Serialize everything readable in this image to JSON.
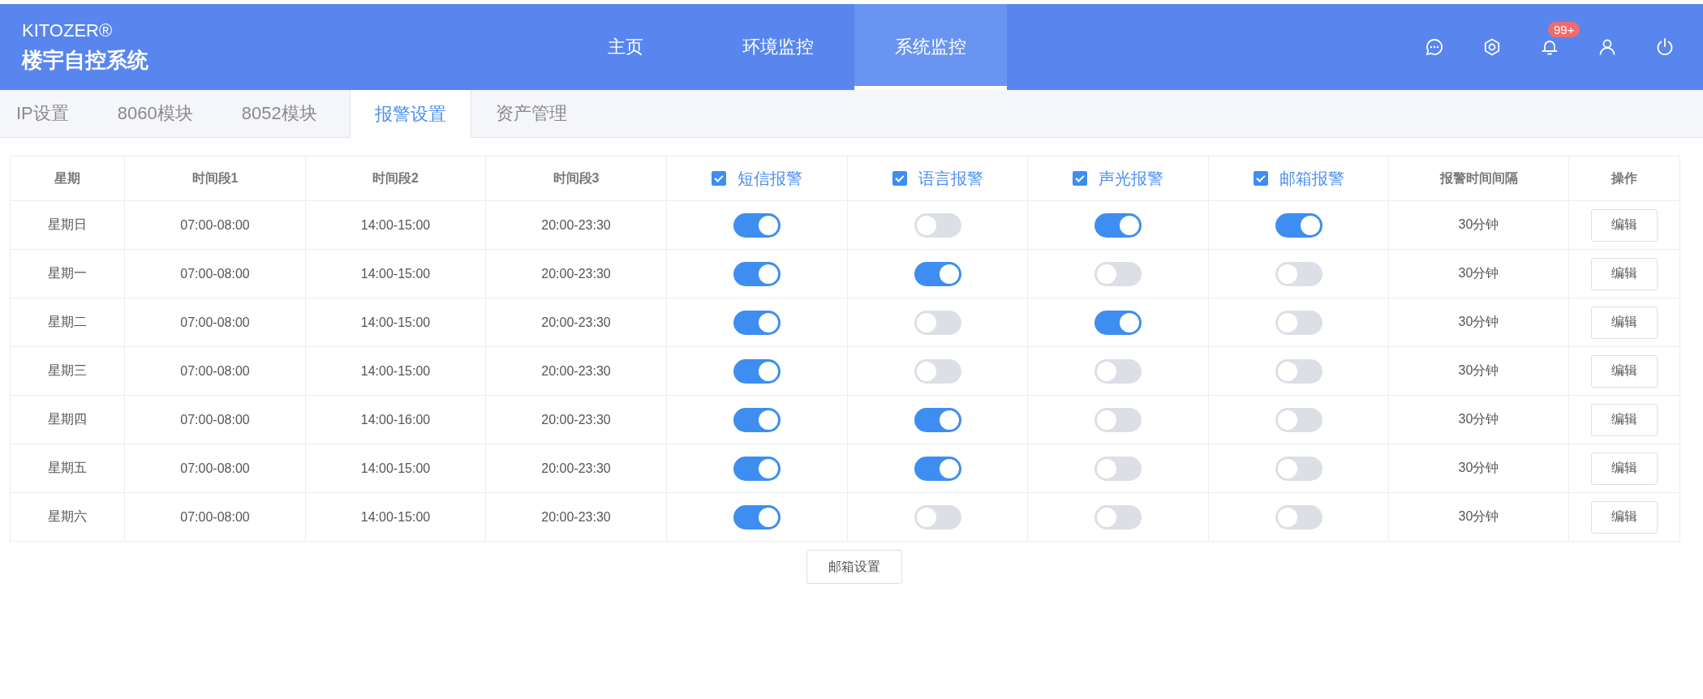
{
  "brand": {
    "name": "KITOZER®",
    "subtitle": "楼宇自控系统"
  },
  "nav": [
    {
      "label": "主页",
      "selected": false
    },
    {
      "label": "环境监控",
      "selected": false
    },
    {
      "label": "系统监控",
      "selected": true
    }
  ],
  "notification_badge": "99+",
  "subtabs": [
    {
      "label": "IP设置",
      "selected": false
    },
    {
      "label": "8060模块",
      "selected": false
    },
    {
      "label": "8052模块",
      "selected": false
    },
    {
      "label": "报警设置",
      "selected": true
    },
    {
      "label": "资产管理",
      "selected": false
    }
  ],
  "table": {
    "columns": [
      {
        "label": "星期",
        "kind": "text"
      },
      {
        "label": "时间段1",
        "kind": "text"
      },
      {
        "label": "时间段2",
        "kind": "text"
      },
      {
        "label": "时间段3",
        "kind": "text"
      },
      {
        "label": "短信报警",
        "kind": "check",
        "checked": true
      },
      {
        "label": "语言报警",
        "kind": "check",
        "checked": true
      },
      {
        "label": "声光报警",
        "kind": "check",
        "checked": true
      },
      {
        "label": "邮箱报警",
        "kind": "check",
        "checked": true
      },
      {
        "label": "报警时间间隔",
        "kind": "text"
      },
      {
        "label": "操作",
        "kind": "text"
      }
    ],
    "rows": [
      {
        "day": "星期日",
        "t1": "07:00-08:00",
        "t2": "14:00-15:00",
        "t3": "20:00-23:30",
        "sms": true,
        "voice": false,
        "light": true,
        "mail": true,
        "interval": "30分钟",
        "action": "编辑"
      },
      {
        "day": "星期一",
        "t1": "07:00-08:00",
        "t2": "14:00-15:00",
        "t3": "20:00-23:30",
        "sms": true,
        "voice": true,
        "light": false,
        "mail": false,
        "interval": "30分钟",
        "action": "编辑"
      },
      {
        "day": "星期二",
        "t1": "07:00-08:00",
        "t2": "14:00-15:00",
        "t3": "20:00-23:30",
        "sms": true,
        "voice": false,
        "light": true,
        "mail": false,
        "interval": "30分钟",
        "action": "编辑"
      },
      {
        "day": "星期三",
        "t1": "07:00-08:00",
        "t2": "14:00-15:00",
        "t3": "20:00-23:30",
        "sms": true,
        "voice": false,
        "light": false,
        "mail": false,
        "interval": "30分钟",
        "action": "编辑"
      },
      {
        "day": "星期四",
        "t1": "07:00-08:00",
        "t2": "14:00-16:00",
        "t3": "20:00-23:30",
        "sms": true,
        "voice": true,
        "light": false,
        "mail": false,
        "interval": "30分钟",
        "action": "编辑"
      },
      {
        "day": "星期五",
        "t1": "07:00-08:00",
        "t2": "14:00-15:00",
        "t3": "20:00-23:30",
        "sms": true,
        "voice": true,
        "light": false,
        "mail": false,
        "interval": "30分钟",
        "action": "编辑"
      },
      {
        "day": "星期六",
        "t1": "07:00-08:00",
        "t2": "14:00-15:00",
        "t3": "20:00-23:30",
        "sms": true,
        "voice": false,
        "light": false,
        "mail": false,
        "interval": "30分钟",
        "action": "编辑"
      }
    ]
  },
  "mail_settings_button": "邮箱设置"
}
